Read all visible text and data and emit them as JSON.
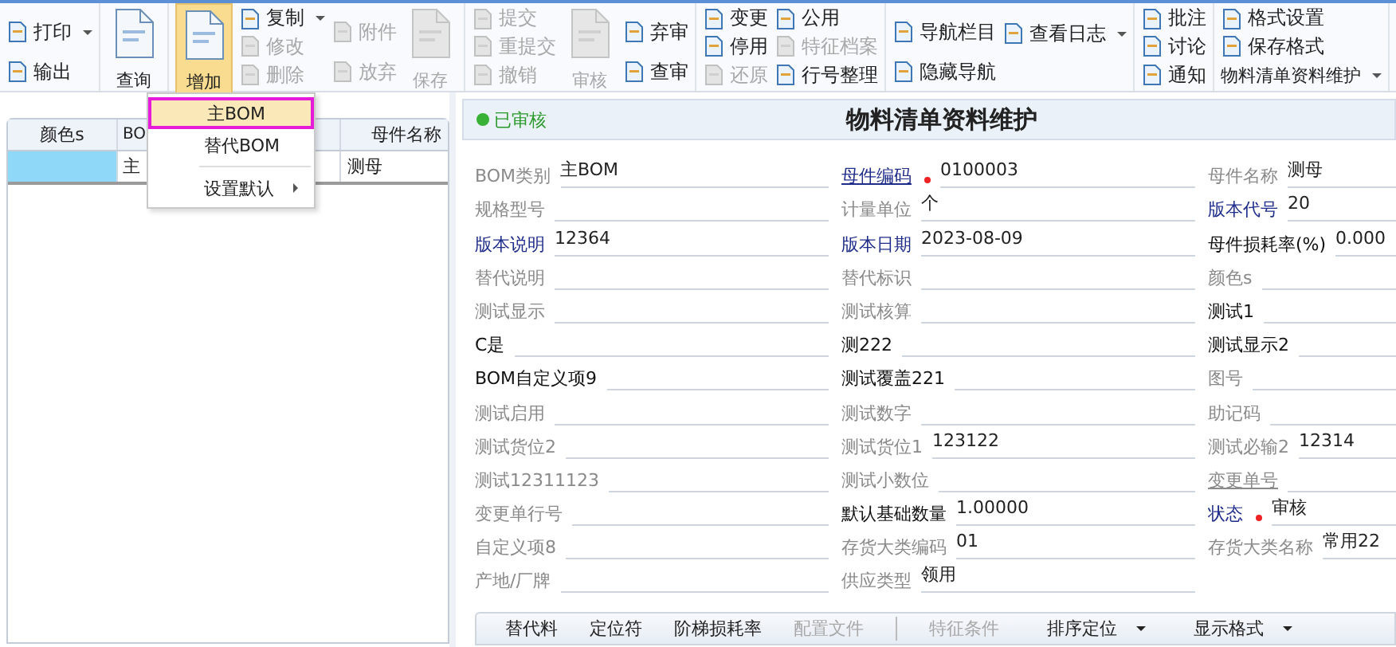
{
  "toolbar": {
    "groups": [
      {
        "columns": [
          {
            "kind": "stack",
            "items": [
              {
                "kind": "button",
                "label": "打印",
                "disabled": false,
                "dropdown": true
              },
              {
                "kind": "button",
                "label": "输出",
                "disabled": false,
                "dropdown": false
              }
            ]
          }
        ]
      },
      {
        "columns": [
          {
            "kind": "large",
            "label": "查询",
            "disabled": false,
            "selected": false,
            "dropdown": false
          }
        ]
      },
      {
        "columns": [
          {
            "kind": "large",
            "label": "增加",
            "disabled": false,
            "selected": true,
            "dropdown": true
          },
          {
            "kind": "stack",
            "items": [
              {
                "kind": "button",
                "label": "复制",
                "disabled": false,
                "dropdown": true
              },
              {
                "kind": "button",
                "label": "修改",
                "disabled": true,
                "dropdown": false
              },
              {
                "kind": "button",
                "label": "删除",
                "disabled": true,
                "dropdown": false
              }
            ]
          },
          {
            "kind": "stack",
            "items": [
              {
                "kind": "button",
                "label": "附件",
                "disabled": true,
                "dropdown": false
              },
              {
                "kind": "button",
                "label": "放弃",
                "disabled": true,
                "dropdown": false
              }
            ]
          },
          {
            "kind": "large",
            "label": "保存",
            "disabled": true,
            "selected": false,
            "dropdown": false
          }
        ]
      },
      {
        "columns": [
          {
            "kind": "stack",
            "items": [
              {
                "kind": "button",
                "label": "提交",
                "disabled": true,
                "dropdown": false
              },
              {
                "kind": "button",
                "label": "重提交",
                "disabled": true,
                "dropdown": false
              },
              {
                "kind": "button",
                "label": "撤销",
                "disabled": true,
                "dropdown": false
              }
            ]
          },
          {
            "kind": "large",
            "label": "审核",
            "disabled": true,
            "selected": false,
            "dropdown": false
          },
          {
            "kind": "stack",
            "items": [
              {
                "kind": "button",
                "label": "弃审",
                "disabled": false,
                "dropdown": false
              },
              {
                "kind": "button",
                "label": "查审",
                "disabled": false,
                "dropdown": false
              }
            ]
          }
        ]
      },
      {
        "columns": [
          {
            "kind": "stack",
            "items": [
              {
                "kind": "button",
                "label": "变更",
                "disabled": false,
                "dropdown": false
              },
              {
                "kind": "button",
                "label": "停用",
                "disabled": false,
                "dropdown": false
              },
              {
                "kind": "button",
                "label": "还原",
                "disabled": true,
                "dropdown": false
              }
            ]
          },
          {
            "kind": "stack",
            "items": [
              {
                "kind": "button",
                "label": "公用",
                "disabled": false,
                "dropdown": false
              },
              {
                "kind": "button",
                "label": "特征档案",
                "disabled": true,
                "dropdown": false
              },
              {
                "kind": "button",
                "label": "行号整理",
                "disabled": false,
                "dropdown": false
              }
            ]
          }
        ]
      },
      {
        "columns": [
          {
            "kind": "stack",
            "items": [
              {
                "kind": "button",
                "label": "导航栏目",
                "disabled": false,
                "dropdown": false
              },
              {
                "kind": "button",
                "label": "隐藏导航",
                "disabled": false,
                "dropdown": false
              }
            ]
          },
          {
            "kind": "stack",
            "items": [
              {
                "kind": "button",
                "label": "查看日志",
                "disabled": false,
                "dropdown": true
              }
            ]
          }
        ]
      },
      {
        "columns": [
          {
            "kind": "stack",
            "items": [
              {
                "kind": "button",
                "label": "批注",
                "disabled": false,
                "dropdown": false
              },
              {
                "kind": "button",
                "label": "讨论",
                "disabled": false,
                "dropdown": false
              },
              {
                "kind": "button",
                "label": "通知",
                "disabled": false,
                "dropdown": false
              }
            ]
          }
        ]
      },
      {
        "columns": [
          {
            "kind": "stack",
            "items": [
              {
                "kind": "button",
                "label": "格式设置",
                "disabled": false,
                "dropdown": false
              },
              {
                "kind": "button",
                "label": "保存格式",
                "disabled": false,
                "dropdown": false
              },
              {
                "kind": "menu",
                "label": "物料清单资料维护",
                "disabled": false,
                "dropdown": true
              }
            ]
          }
        ]
      }
    ]
  },
  "add_menu": {
    "items": [
      {
        "kind": "item",
        "label": "主BOM",
        "selected": true,
        "submenu": false
      },
      {
        "kind": "item",
        "label": "替代BOM",
        "selected": false,
        "submenu": false
      },
      {
        "kind": "separator"
      },
      {
        "kind": "item",
        "label": "设置默认",
        "selected": false,
        "submenu": true
      }
    ]
  },
  "list": {
    "columns": [
      "颜色s",
      "BO",
      "母件名称"
    ],
    "rows": [
      {
        "selected": true,
        "column_2": "主",
        "column_3": "测母"
      }
    ]
  },
  "form": {
    "status": "已审核",
    "title": "物料清单资料维护",
    "fields": [
      {
        "label": "BOM类别",
        "kind": "plain",
        "required": false,
        "value": "主BOM"
      },
      {
        "label": "母件编码",
        "kind": "link-underlined",
        "required": true,
        "value": "0100003"
      },
      {
        "label": "母件名称",
        "kind": "plain",
        "required": false,
        "value": "测母"
      },
      {
        "label": "规格型号",
        "kind": "plain",
        "required": false
      },
      {
        "label": "计量单位",
        "kind": "plain",
        "required": false,
        "value": "个"
      },
      {
        "label": "版本代号",
        "kind": "link",
        "required": false,
        "value": "20"
      },
      {
        "label": "版本说明",
        "kind": "link",
        "required": false,
        "value": "12364"
      },
      {
        "label": "版本日期",
        "kind": "link",
        "required": false,
        "value": "2023-08-09"
      },
      {
        "label": "母件损耗率(%)",
        "kind": "strong",
        "required": false,
        "value": "0.000"
      },
      {
        "label": "替代说明",
        "kind": "plain",
        "required": false
      },
      {
        "label": "替代标识",
        "kind": "plain",
        "required": false
      },
      {
        "label": "颜色s",
        "kind": "plain",
        "required": false
      },
      {
        "label": "测试显示",
        "kind": "plain",
        "required": false
      },
      {
        "label": "测试核算",
        "kind": "plain",
        "required": false
      },
      {
        "label": "测试1",
        "kind": "strong",
        "required": false
      },
      {
        "label": "C是",
        "kind": "strong",
        "required": false
      },
      {
        "label": "测222",
        "kind": "strong",
        "required": false
      },
      {
        "label": "测试显示2",
        "kind": "strong",
        "required": false
      },
      {
        "label": "BOM自定义项9",
        "kind": "strong",
        "required": false
      },
      {
        "label": "测试覆盖221",
        "kind": "strong",
        "required": false
      },
      {
        "label": "图号",
        "kind": "plain",
        "required": false
      },
      {
        "label": "测试启用",
        "kind": "plain",
        "required": false
      },
      {
        "label": "测试数字",
        "kind": "plain",
        "required": false
      },
      {
        "label": "助记码",
        "kind": "plain",
        "required": false
      },
      {
        "label": "测试货位2",
        "kind": "plain",
        "required": false
      },
      {
        "label": "测试货位1",
        "kind": "plain",
        "required": false,
        "value": "123122"
      },
      {
        "label": "测试必输2",
        "kind": "plain",
        "required": false,
        "value": "12314"
      },
      {
        "label": "测试12311123",
        "kind": "plain",
        "required": false
      },
      {
        "label": "测试小数位",
        "kind": "plain",
        "required": false
      },
      {
        "label": "变更单号",
        "kind": "underlined",
        "required": false
      },
      {
        "label": "变更单行号",
        "kind": "plain",
        "required": false
      },
      {
        "label": "默认基础数量",
        "kind": "strong",
        "required": false,
        "value": "1.00000"
      },
      {
        "label": "状态",
        "kind": "link",
        "required": true,
        "value": "审核"
      },
      {
        "label": "自定义项8",
        "kind": "plain",
        "required": false
      },
      {
        "label": "存货大类编码",
        "kind": "plain",
        "required": false,
        "value": "01"
      },
      {
        "label": "存货大类名称",
        "kind": "plain",
        "required": false,
        "value": "常用22"
      },
      {
        "label": "产地/厂牌",
        "kind": "plain",
        "required": false
      },
      {
        "label": "供应类型",
        "kind": "plain",
        "required": false,
        "value": "领用"
      }
    ]
  },
  "detail_tabs": [
    {
      "kind": "tab",
      "label": "替代料",
      "disabled": false,
      "dropdown": false
    },
    {
      "kind": "tab",
      "label": "定位符",
      "disabled": false,
      "dropdown": false
    },
    {
      "kind": "tab",
      "label": "阶梯损耗率",
      "disabled": false,
      "dropdown": false
    },
    {
      "kind": "tab",
      "label": "配置文件",
      "disabled": true,
      "dropdown": false
    },
    {
      "kind": "separator"
    },
    {
      "kind": "tab",
      "label": "特征条件",
      "disabled": true,
      "dropdown": false
    },
    {
      "kind": "tab",
      "label": "排序定位",
      "disabled": false,
      "dropdown": true
    },
    {
      "kind": "tab",
      "label": "显示格式",
      "disabled": false,
      "dropdown": true
    }
  ]
}
